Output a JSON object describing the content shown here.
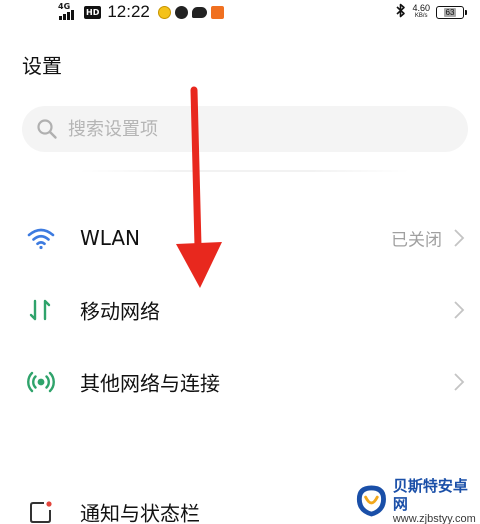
{
  "status_bar": {
    "network": "4G",
    "hd": "HD",
    "time": "12:22",
    "speed_value": "4.60",
    "speed_unit": "KB/s",
    "battery": "63",
    "icons": [
      "signal-icon",
      "hd-icon",
      "app-notification-icon",
      "compass-icon",
      "chat-bubble-icon",
      "app-icon",
      "bluetooth-icon",
      "battery-icon"
    ]
  },
  "header": {
    "title": "设置"
  },
  "search": {
    "placeholder": "搜索设置项",
    "icon": "search-icon"
  },
  "settings": [
    {
      "label": "WLAN",
      "value": "已关闭",
      "icon": "wifi-icon",
      "icon_color": "#3d7be0"
    },
    {
      "label": "移动网络",
      "value": "",
      "icon": "mobile-data-icon",
      "icon_color": "#2fa36b"
    },
    {
      "label": "其他网络与连接",
      "value": "",
      "icon": "other-networks-icon",
      "icon_color": "#2fa36b"
    },
    {
      "label": "通知与状态栏",
      "value": "",
      "icon": "notification-icon",
      "icon_color": "#333333"
    }
  ],
  "annotation": {
    "arrow_color": "#e8281e"
  },
  "watermark": {
    "title": "贝斯特安卓网",
    "url": "www.zjbstyy.com"
  }
}
